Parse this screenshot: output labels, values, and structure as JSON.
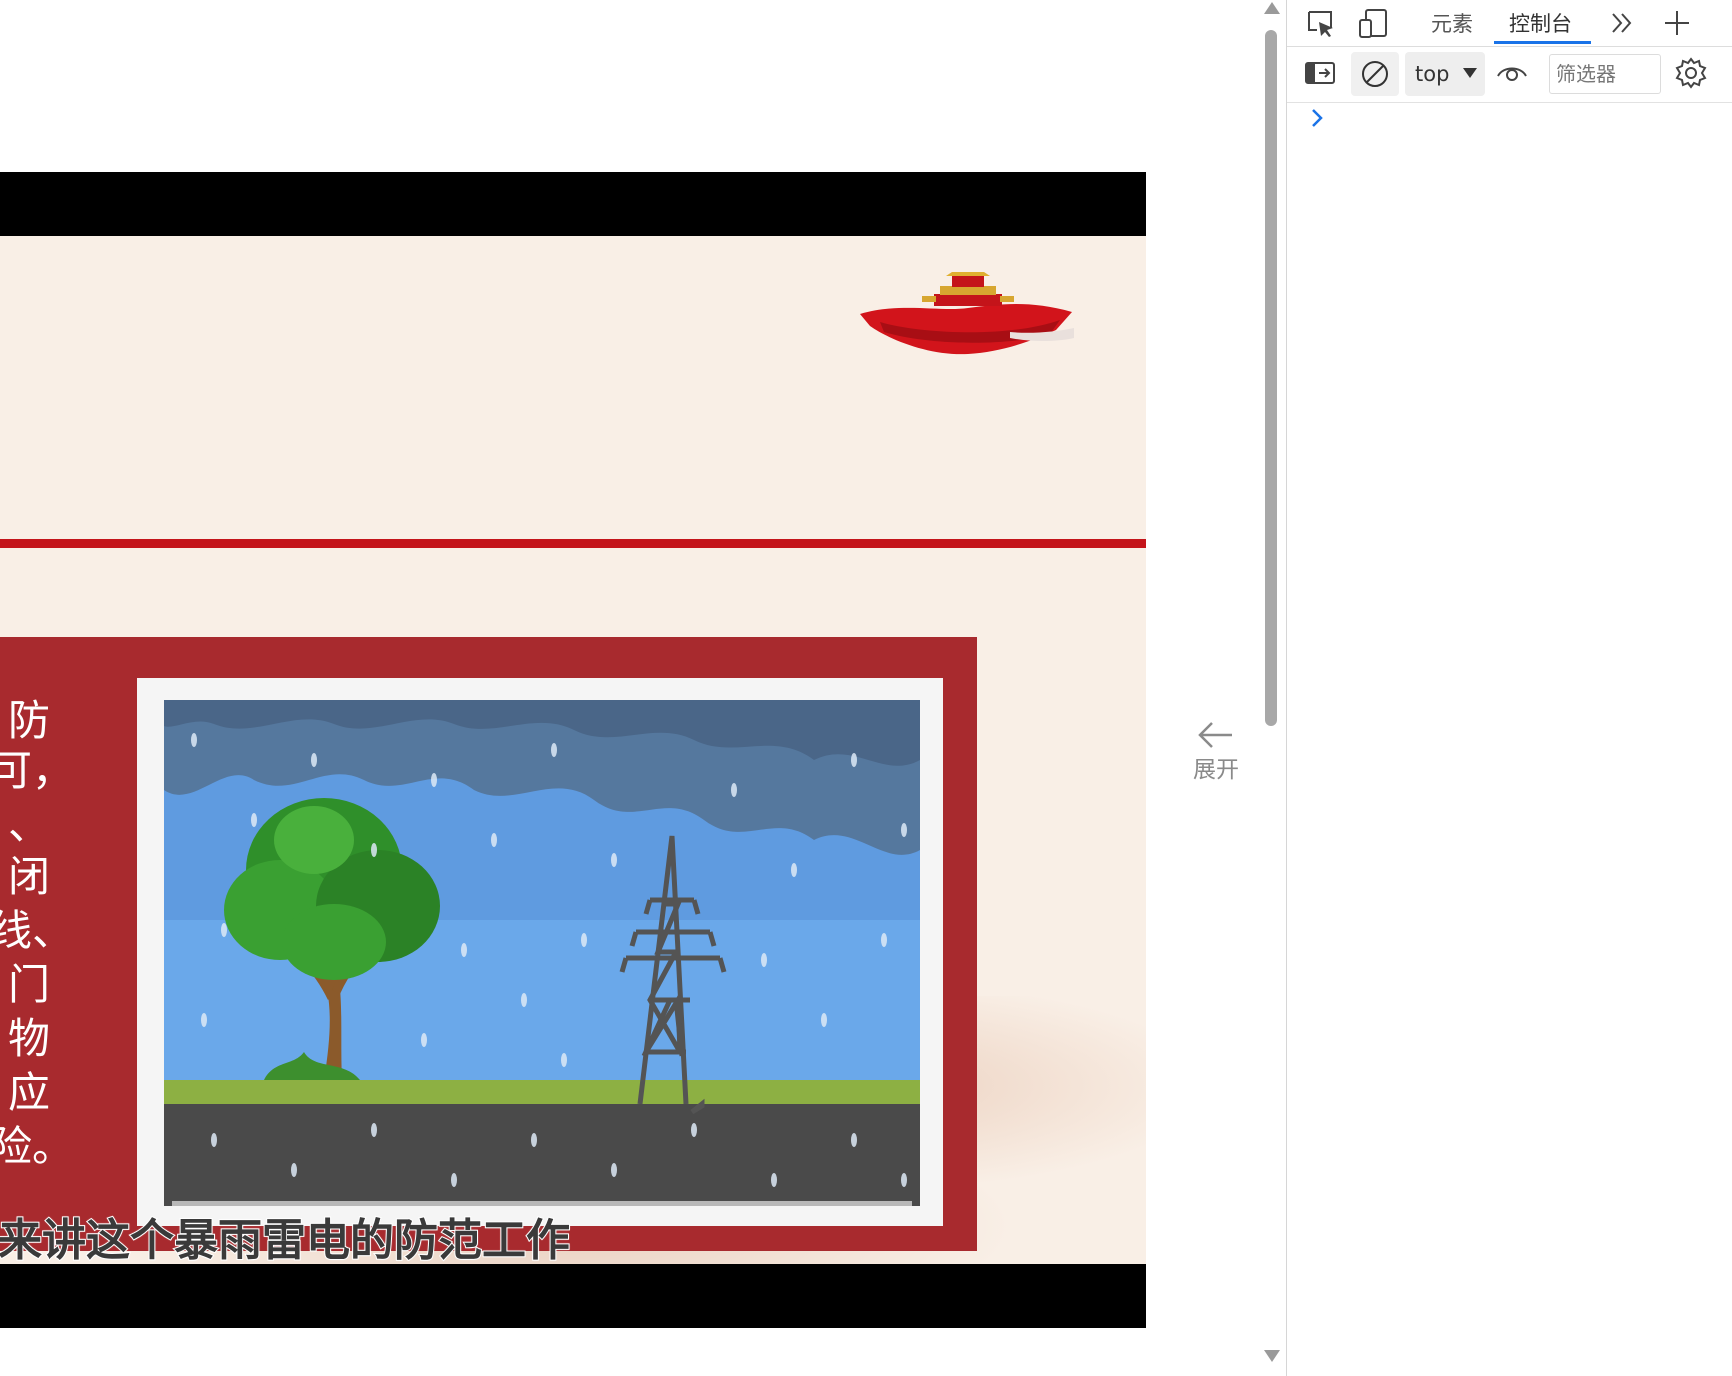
{
  "video": {
    "slide_text_fragments": [
      "防",
      "可，",
      "、",
      "闭",
      "线、",
      "门",
      "物",
      "应",
      "险。"
    ],
    "subtitle": "来讲这个暴雨雷电的防范工作"
  },
  "side_panel": {
    "expand_label": "展开"
  },
  "devtools": {
    "tabs": [
      "元素",
      "控制台"
    ],
    "active_tab": "控制台",
    "context": "top",
    "filter_placeholder": "筛选器"
  },
  "colors": {
    "slide_background": "#f9efe6",
    "red_accent": "#c4141a",
    "frame_red": "#a82a2e",
    "devtools_accent": "#1a73e8"
  },
  "icons": [
    "inspect-icon",
    "device-toolbar-icon",
    "more-tabs-icon",
    "add-tab-icon",
    "sidebar-toggle-icon",
    "clear-console-icon",
    "eye-icon",
    "gear-icon",
    "prompt-chevron-icon",
    "arrow-left-icon"
  ]
}
